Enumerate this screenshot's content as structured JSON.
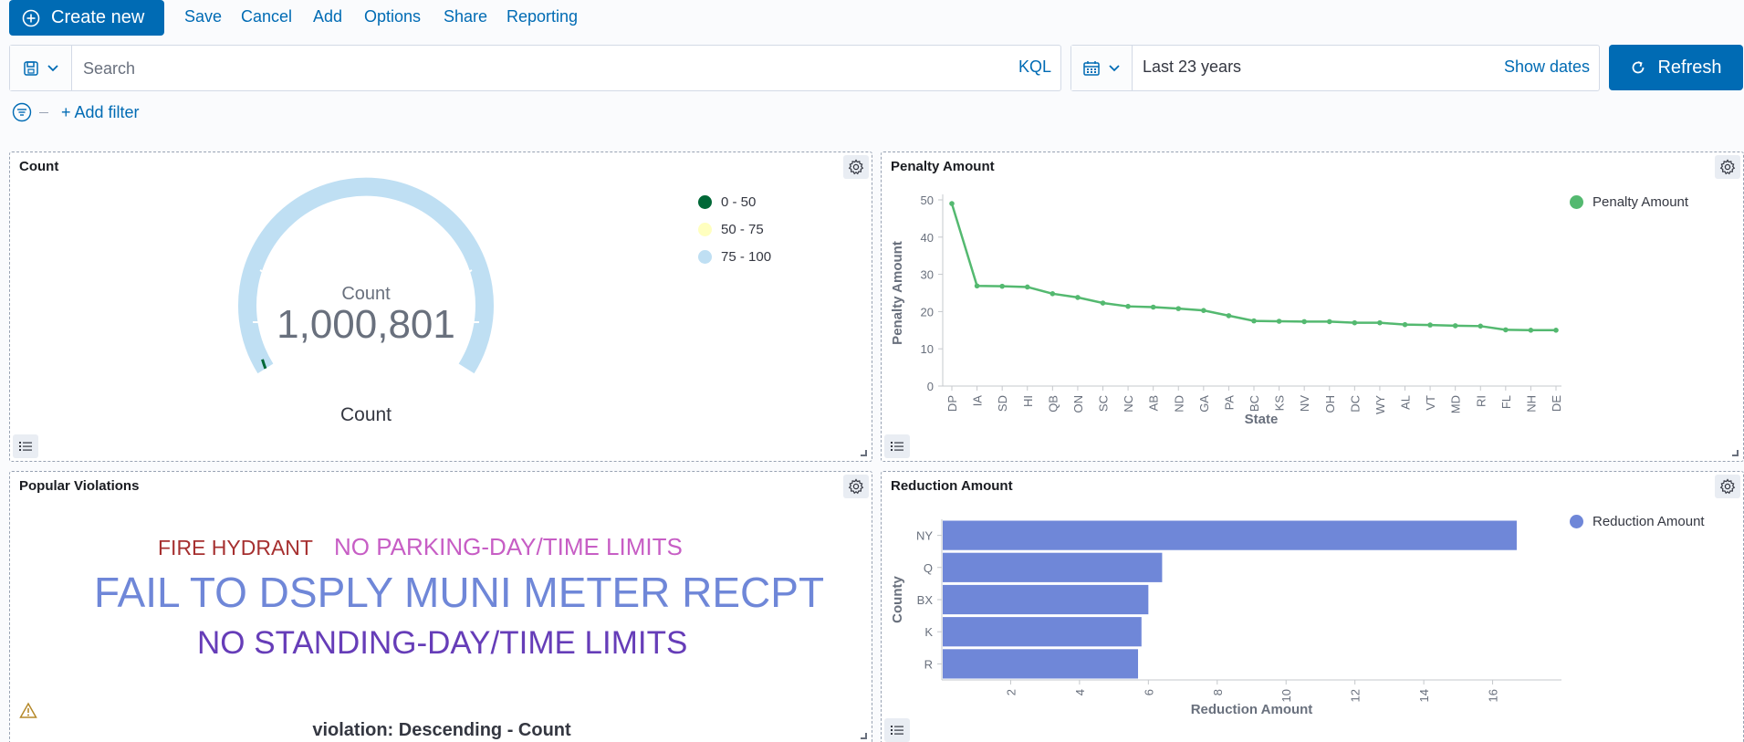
{
  "toolbar": {
    "create_label": "Create new",
    "links": [
      "Save",
      "Cancel",
      "Add",
      "Options",
      "Share",
      "Reporting"
    ]
  },
  "query": {
    "placeholder": "Search",
    "language": "KQL",
    "date_range": "Last 23 years",
    "show_dates": "Show dates",
    "refresh": "Refresh",
    "add_filter": "+ Add filter"
  },
  "colors": {
    "primary": "#006bb4",
    "gauge_blue": "#bfdff3",
    "gauge_green": "#006837",
    "line_green": "#54b970",
    "bar_blue": "#6f87d8"
  },
  "panels": {
    "count": {
      "title": "Count",
      "metric_label": "Count",
      "metric_value": "1,000,801",
      "bottom_label": "Count",
      "legend": [
        {
          "label": "0 - 50",
          "color": "#006837"
        },
        {
          "label": "50 - 75",
          "color": "#ffffbf"
        },
        {
          "label": "75 - 100",
          "color": "#bfdff3"
        }
      ]
    },
    "penalty": {
      "title": "Penalty Amount",
      "legend": "Penalty Amount"
    },
    "popular": {
      "title": "Popular Violations",
      "footer": "violation: Descending - Count",
      "words": [
        {
          "text": "FIRE HYDRANT",
          "color": "#a63030"
        },
        {
          "text": "NO PARKING-DAY/TIME LIMITS",
          "color": "#c75ec5"
        },
        {
          "text": "FAIL TO DSPLY MUNI METER RECPT",
          "color": "#6f87d8"
        },
        {
          "text": "NO STANDING-DAY/TIME LIMITS",
          "color": "#663db8"
        }
      ]
    },
    "reduction": {
      "title": "Reduction Amount",
      "legend": "Reduction Amount"
    }
  },
  "chart_data": [
    {
      "type": "gauge",
      "title": "Count",
      "value": 1000801,
      "ranges": [
        [
          0,
          50
        ],
        [
          50,
          75
        ],
        [
          75,
          100
        ]
      ]
    },
    {
      "type": "line",
      "title": "Penalty Amount",
      "xlabel": "State",
      "ylabel": "Penalty Amount",
      "categories": [
        "DP",
        "IA",
        "SD",
        "HI",
        "QB",
        "ON",
        "SC",
        "NC",
        "AB",
        "ND",
        "GA",
        "PA",
        "BC",
        "KS",
        "NV",
        "OH",
        "DC",
        "WY",
        "AL",
        "VT",
        "MD",
        "RI",
        "FL",
        "NH",
        "DE"
      ],
      "series": [
        {
          "name": "Penalty Amount",
          "values": [
            49,
            26.9,
            26.8,
            26.6,
            24.8,
            23.8,
            22.3,
            21.4,
            21.2,
            20.8,
            20.3,
            18.9,
            17.5,
            17.4,
            17.3,
            17.3,
            17.0,
            17.0,
            16.5,
            16.4,
            16.2,
            16.1,
            15.1,
            15.0,
            15.0
          ]
        }
      ],
      "ylim": [
        0,
        50
      ],
      "yticks": [
        0,
        10,
        20,
        30,
        40,
        50
      ]
    },
    {
      "type": "bar",
      "orientation": "horizontal",
      "title": "Reduction Amount",
      "xlabel": "Reduction Amount",
      "ylabel": "County",
      "categories": [
        "NY",
        "Q",
        "BX",
        "K",
        "R"
      ],
      "series": [
        {
          "name": "Reduction Amount",
          "values": [
            16.7,
            6.4,
            6.0,
            5.8,
            5.7
          ]
        }
      ],
      "xlim": [
        0,
        18
      ],
      "xticks": [
        2,
        4,
        6,
        8,
        10,
        12,
        14,
        16
      ]
    }
  ]
}
